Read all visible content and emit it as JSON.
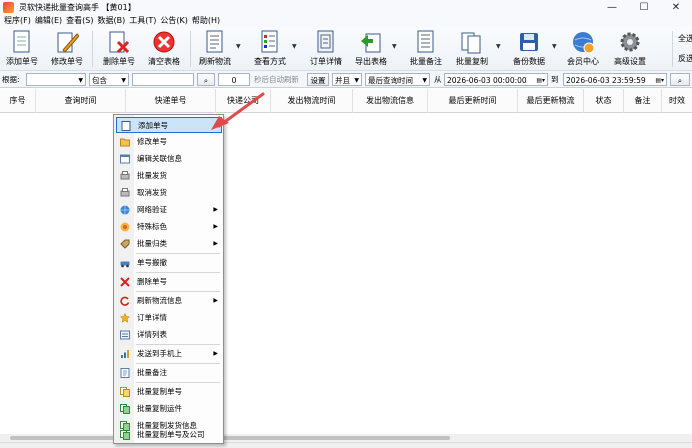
{
  "window": {
    "title": "灵软快递批量查询高手 【黄01】",
    "controls": [
      "—",
      "☐",
      "✕"
    ]
  },
  "menubar": [
    "程序(F)",
    "编辑(E)",
    "查看(S)",
    "数据(B)",
    "工具(T)",
    "公告(K)",
    "帮助(H)"
  ],
  "toolbar": {
    "add": "添加单号",
    "edit": "修改单号",
    "delete": "删除单号",
    "clear": "清空表格",
    "refresh": "刷新物流",
    "view_mode": "查看方式",
    "order_detail": "订单详情",
    "export": "导出表格",
    "batch_note": "批量备注",
    "batch_copy": "批量复制",
    "backup": "备份数据",
    "member": "会员中心",
    "settings": "高级设置",
    "right_1": "全选",
    "right_2": "反选"
  },
  "filterbar": {
    "basis_label": "根据:",
    "basis_value": "",
    "match_value": "包含",
    "keyword_value": "",
    "auto_seconds": "0",
    "auto_label": "秒后自动刷新",
    "set_button": "设置",
    "logic_value": "并且",
    "time_field": "最后查询时间",
    "from_label": "从",
    "date_from": "2026-06-03 00:00:00",
    "to_label": "到",
    "date_to": "2026-06-03 23:59:59"
  },
  "table": {
    "columns": [
      "序号",
      "查询时间",
      "快递单号",
      "快递公司",
      "发出物流时间",
      "发出物流信息",
      "最后更新时间",
      "最后更新物流",
      "状态",
      "备注",
      "时效"
    ]
  },
  "context_menu": {
    "items": [
      {
        "label": "添加单号",
        "icon": "add-doc-icon",
        "selected": true
      },
      {
        "label": "修改单号",
        "icon": "folder-icon"
      },
      {
        "label": "编辑关联信息",
        "icon": "edit-window-icon"
      },
      {
        "label": "批量发货",
        "icon": "print-icon"
      },
      {
        "label": "取消发货",
        "icon": "cancel-print-icon"
      },
      {
        "label": "网络验证",
        "icon": "globe-icon",
        "submenu": true
      },
      {
        "label": "特殊标色",
        "icon": "color-icon",
        "submenu": true
      },
      {
        "label": "批量归类",
        "icon": "tag-icon",
        "submenu": true
      },
      {
        "label": "单号搬撤",
        "icon": "car-icon"
      },
      {
        "label": "删除单号",
        "icon": "delete-icon"
      },
      {
        "label": "刷新物流信息",
        "icon": "refresh-icon",
        "submenu": true
      },
      {
        "label": "订单详情",
        "icon": "star-icon"
      },
      {
        "label": "详情列表",
        "icon": "list-icon"
      },
      {
        "label": "发送到手机上",
        "icon": "chart-icon",
        "submenu": true
      },
      {
        "label": "批量备注",
        "icon": "note-icon"
      },
      {
        "label": "批量复制单号",
        "icon": "copy-icon"
      },
      {
        "label": "批量复制运件",
        "icon": "copy-green-icon"
      },
      {
        "label": "批量复制发货信息",
        "icon": "copy-green-icon"
      },
      {
        "label": "批量复制单号及公司",
        "icon": "copy-green-icon"
      }
    ]
  },
  "colors": {
    "selection_fill": "#cce4f7",
    "selection_border": "#1e6fd9",
    "arrow": "#e04a4a"
  }
}
